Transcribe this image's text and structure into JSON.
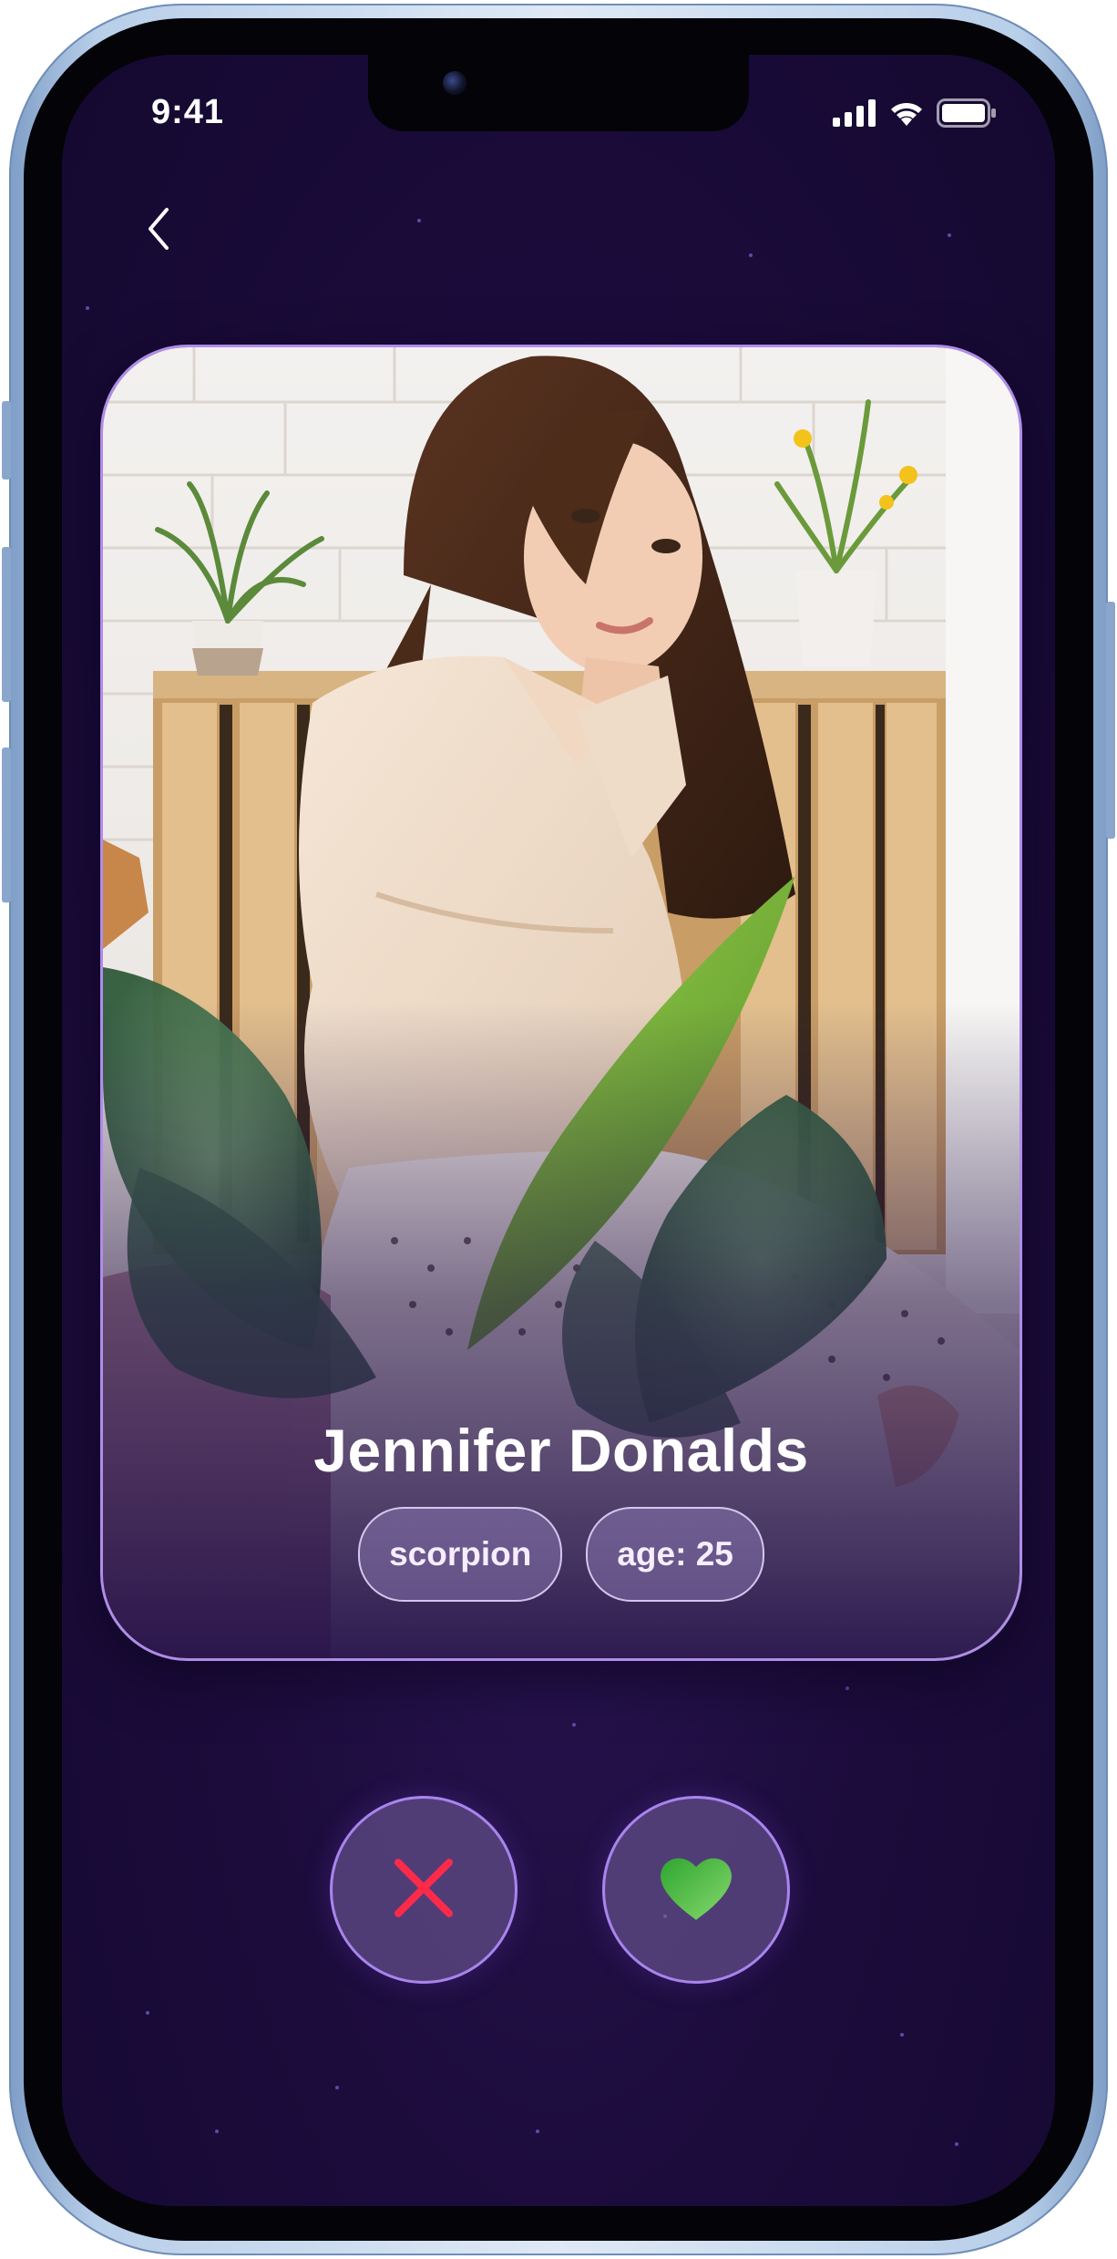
{
  "status_bar": {
    "time": "9:41",
    "signal_icon": "cellular-signal-icon",
    "wifi_icon": "wifi-icon",
    "battery_icon": "battery-icon"
  },
  "navigation": {
    "back_icon": "chevron-left-icon"
  },
  "profile": {
    "name": "Jennifer Donalds",
    "tags": [
      "scorpion",
      "age: 25"
    ]
  },
  "actions": {
    "dislike_icon": "close-icon",
    "like_icon": "heart-icon"
  },
  "colors": {
    "background": "#1d0c3d",
    "card_border": "#b08de8",
    "dislike": "#ff2a4a",
    "like": "#3fbf3f"
  }
}
